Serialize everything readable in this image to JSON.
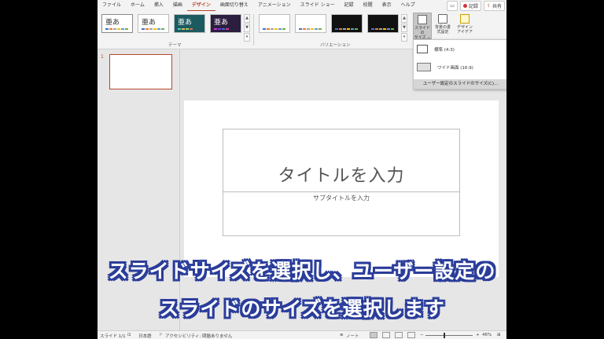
{
  "tabs": [
    "ファイル",
    "ホーム",
    "挿入",
    "描画",
    "デザイン",
    "画面切り替え",
    "アニメーション",
    "スライド ショー",
    "記録",
    "校閲",
    "表示",
    "ヘルプ"
  ],
  "active_tab": "デザイン",
  "top_right": {
    "record_label": "記録",
    "share_label": "共有"
  },
  "ribbon": {
    "themes_group_label": "テーマ",
    "variations_group_label": "バリエーション",
    "theme_thumb_text": [
      "亜あ",
      "亜あ",
      "亜あ",
      "亜あ"
    ],
    "slide_size_label": "スライドのサイズ",
    "slide_size_label_1": "スライドの",
    "slide_size_label_2": "サイズ ⌄",
    "format_bg_label_1": "背景の書",
    "format_bg_label_2": "式設定",
    "designer_label_1": "デザイン",
    "designer_label_2": "アイデア"
  },
  "slide_size_menu": {
    "standard": "標準 (4:3)",
    "widescreen": "ワイド画面 (16:9)",
    "custom": "ユーザー設定のスライドのサイズ(C)..."
  },
  "slide_panel": {
    "number": "1"
  },
  "slide": {
    "title_placeholder": "タイトルを入力",
    "subtitle_placeholder": "サブタイトルを入力"
  },
  "status_bar": {
    "slide_info": "スライド 1/1",
    "language": "日本語",
    "accessibility": "アクセシビリティ: 問題ありません",
    "notes": "ノート",
    "zoom": "46%"
  },
  "captions": {
    "line1": "スライドサイズを選択し、ユーザー設定の",
    "line2": "スライドのサイズを選択します"
  },
  "colors": {
    "accent": "#b7472a",
    "caption_outline": "#2a3d9a"
  }
}
